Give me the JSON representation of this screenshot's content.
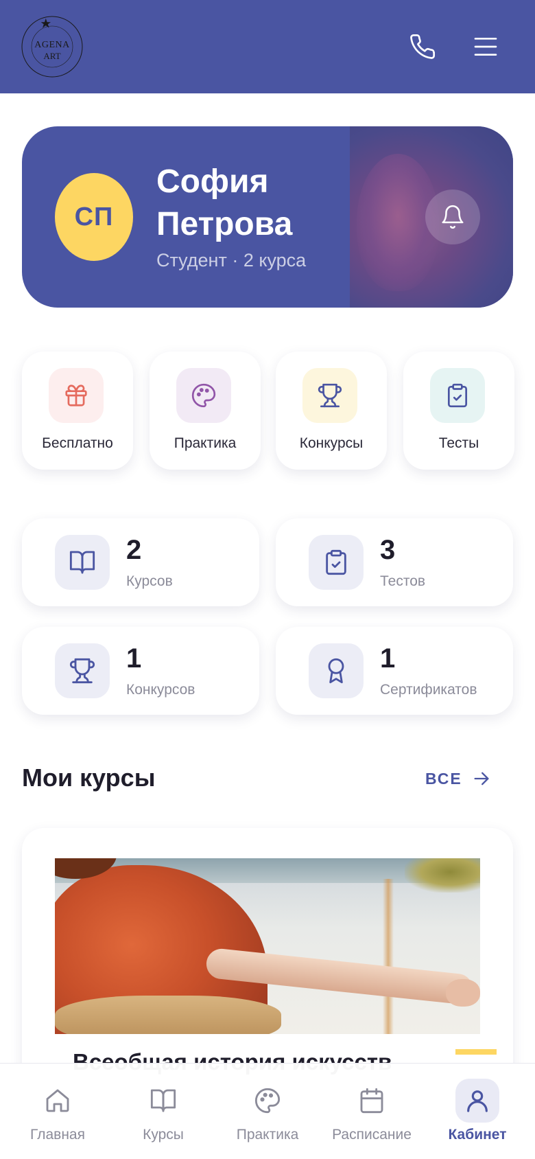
{
  "header": {
    "logo_line1": "AGENA",
    "logo_line2": "ART",
    "logo_ring_top": "INTERNATIONAL ART & ANTIQUE",
    "logo_ring_bottom": "ONLINE ACADEMY № 1",
    "phone_icon": "phone-icon",
    "menu_icon": "menu-icon"
  },
  "profile": {
    "initials": "СП",
    "first_name": "София",
    "last_name": "Петрова",
    "role": "Студент · 2 курса",
    "bell_icon": "bell-icon"
  },
  "quick_actions": [
    {
      "label": "Бесплатно",
      "icon": "gift-icon",
      "bg": "#fdeeee",
      "color": "#e56b5e"
    },
    {
      "label": "Практика",
      "icon": "palette-icon",
      "bg": "#f2eaf5",
      "color": "#9155a8"
    },
    {
      "label": "Конкурсы",
      "icon": "trophy-icon",
      "bg": "#fdf6dd",
      "color": "#4a55a2"
    },
    {
      "label": "Тесты",
      "icon": "clipboard-icon",
      "bg": "#e6f4f3",
      "color": "#4a55a2"
    }
  ],
  "stats": [
    {
      "value": "2",
      "label": "Курсов",
      "icon": "book-icon"
    },
    {
      "value": "3",
      "label": "Тестов",
      "icon": "clipboard-icon"
    },
    {
      "value": "1",
      "label": "Конкурсов",
      "icon": "trophy-icon"
    },
    {
      "value": "1",
      "label": "Сертификатов",
      "icon": "award-icon"
    }
  ],
  "courses_section": {
    "title": "Мои курсы",
    "see_all": "ВСЕ",
    "course_title": "Всеобщая история искусств"
  },
  "bottom_nav": [
    {
      "label": "Главная",
      "icon": "home-icon",
      "active": false
    },
    {
      "label": "Курсы",
      "icon": "book-icon",
      "active": false
    },
    {
      "label": "Практика",
      "icon": "palette-icon",
      "active": false
    },
    {
      "label": "Расписание",
      "icon": "calendar-icon",
      "active": false
    },
    {
      "label": "Кабинет",
      "icon": "user-icon",
      "active": true
    }
  ],
  "colors": {
    "primary": "#4a55a2",
    "accent_yellow": "#fdd662",
    "text": "#1f1d2b",
    "muted": "#8b8b99"
  }
}
